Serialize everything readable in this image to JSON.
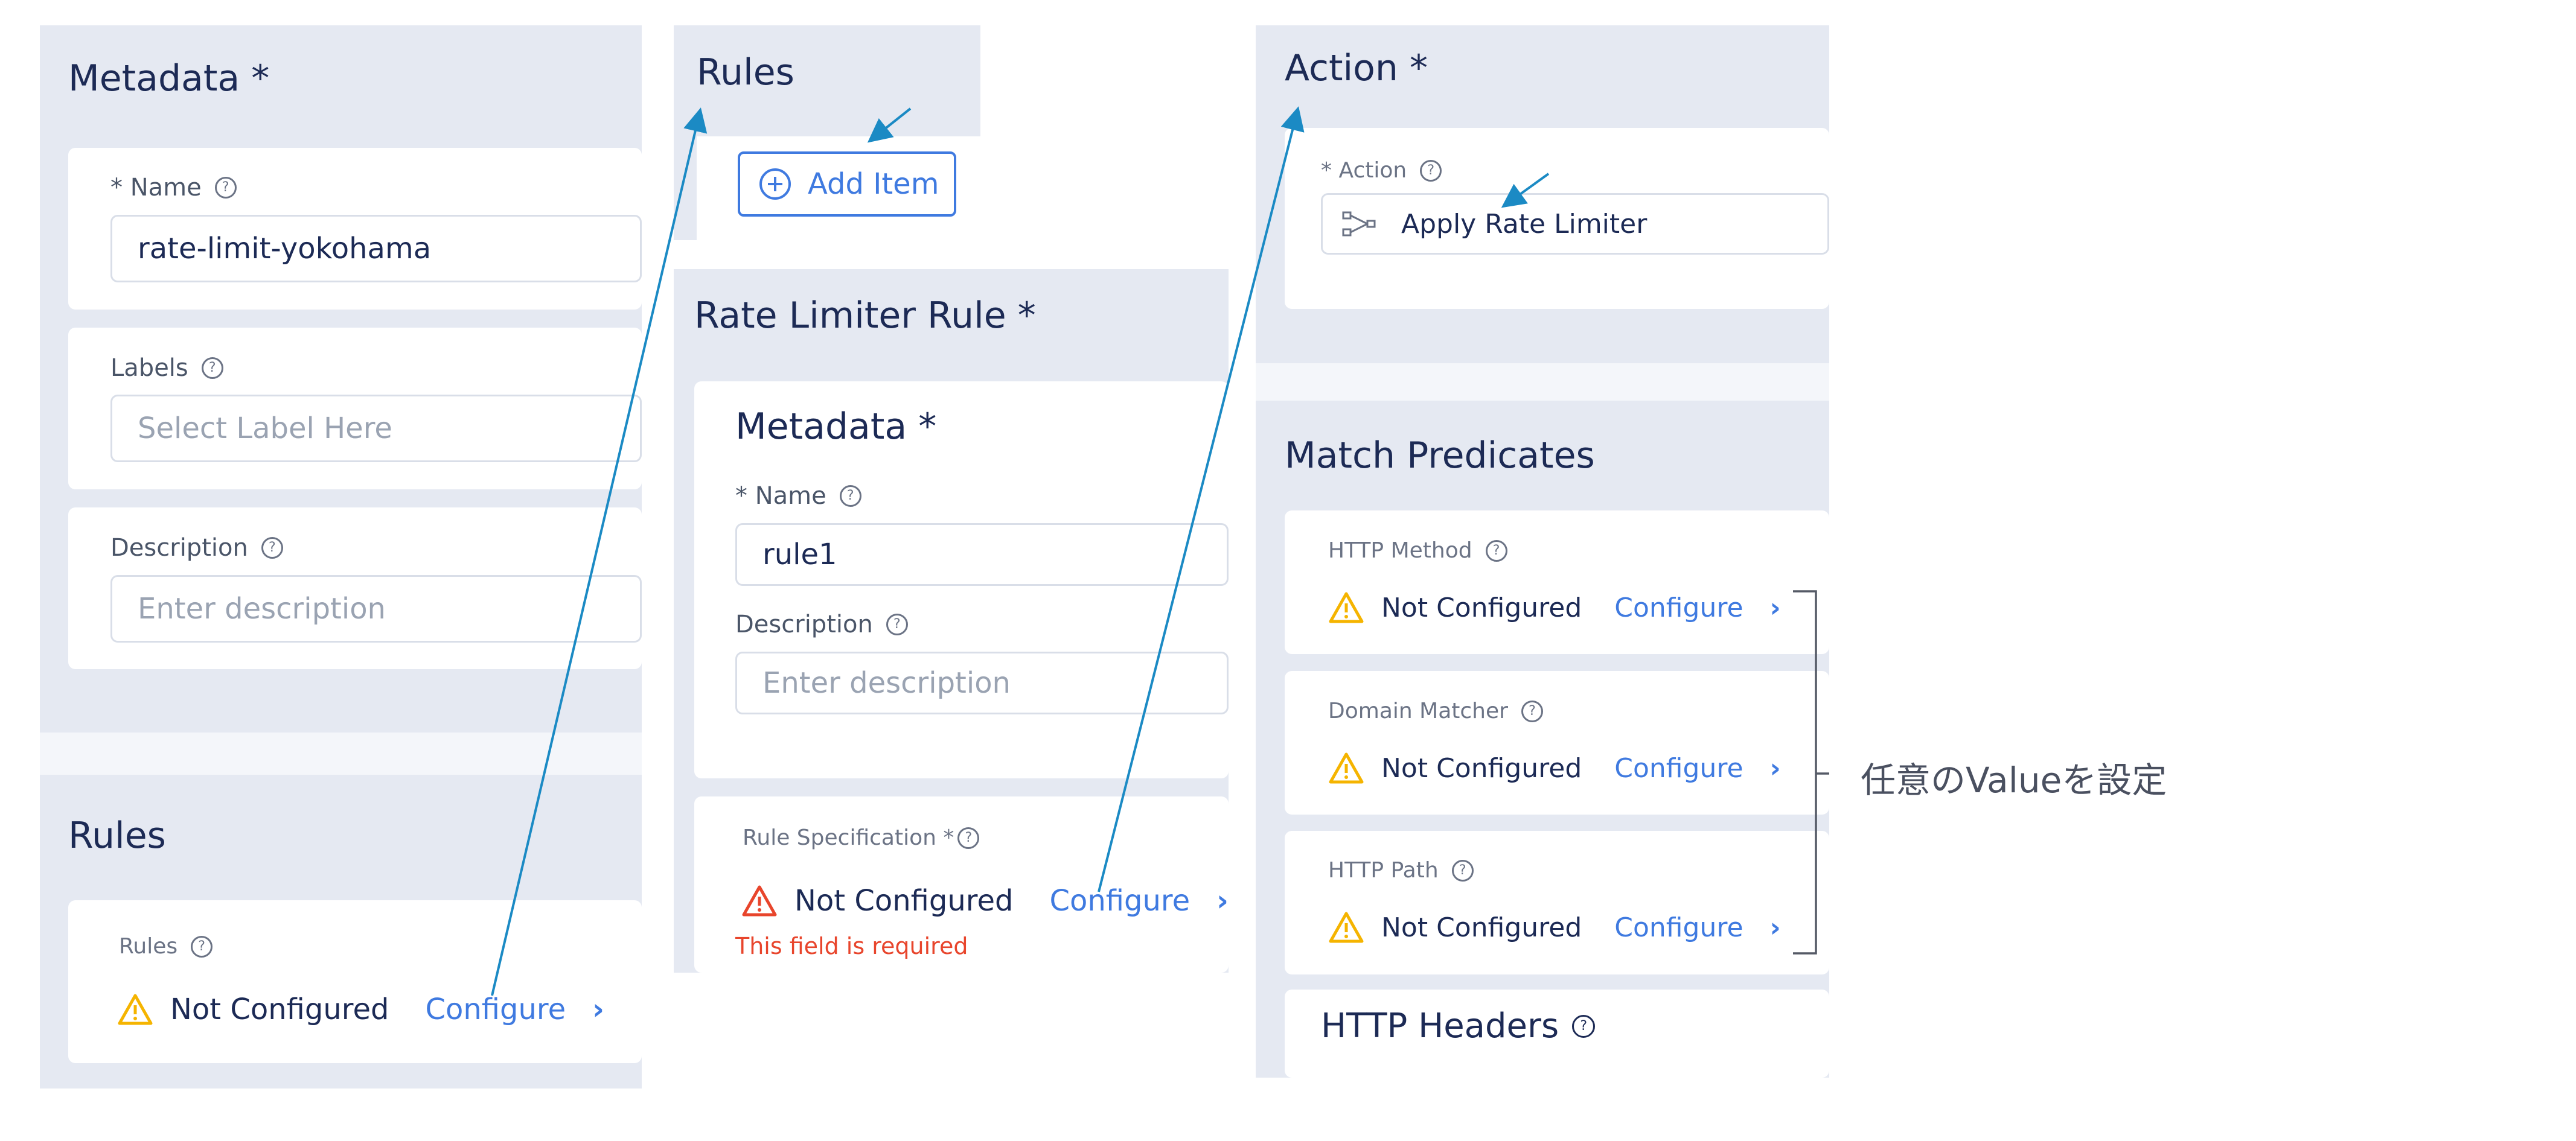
{
  "panel1": {
    "metadata_title": "Metadata *",
    "name_label": "* Name",
    "name_value": "rate-limit-yokohama",
    "labels_label": "Labels",
    "labels_placeholder": "Select Label Here",
    "description_label": "Description",
    "description_placeholder": "Enter description",
    "rules_title": "Rules",
    "rules_label": "Rules",
    "rules_status": "Not Configured",
    "rules_configure": "Configure"
  },
  "panel2": {
    "rules_title": "Rules",
    "add_item_label": "Add Item",
    "rate_limiter_title": "Rate Limiter Rule *",
    "metadata_title": "Metadata *",
    "name_label": "* Name",
    "name_value": "rule1",
    "description_label": "Description",
    "description_placeholder": "Enter description",
    "rule_spec_label": "Rule Specification *",
    "rule_spec_status": "Not Configured",
    "rule_spec_configure": "Configure",
    "rule_spec_error": "This field is required"
  },
  "panel3": {
    "action_title": "Action *",
    "action_label": "* Action",
    "action_value": "Apply Rate Limiter",
    "match_predicates_title": "Match Predicates",
    "predicates": [
      {
        "label": "HTTP Method",
        "status": "Not Configured",
        "configure": "Configure"
      },
      {
        "label": "Domain Matcher",
        "status": "Not Configured",
        "configure": "Configure"
      },
      {
        "label": "HTTP Path",
        "status": "Not Configured",
        "configure": "Configure"
      }
    ],
    "http_headers_title": "HTTP Headers"
  },
  "annotation": {
    "note": "任意のValueを設定"
  },
  "colors": {
    "panel_bg": "#e5e9f2",
    "accent_blue": "#3f7ae0",
    "arrow_blue": "#1b8ac4",
    "warning_yellow": "#f5b400",
    "error_red": "#e8452c"
  },
  "icons": {
    "help": "help-circle-icon",
    "warning": "warning-triangle-icon",
    "error": "error-triangle-icon",
    "add": "plus-circle-icon",
    "chevron": "chevron-right-icon",
    "action": "route-icon"
  }
}
